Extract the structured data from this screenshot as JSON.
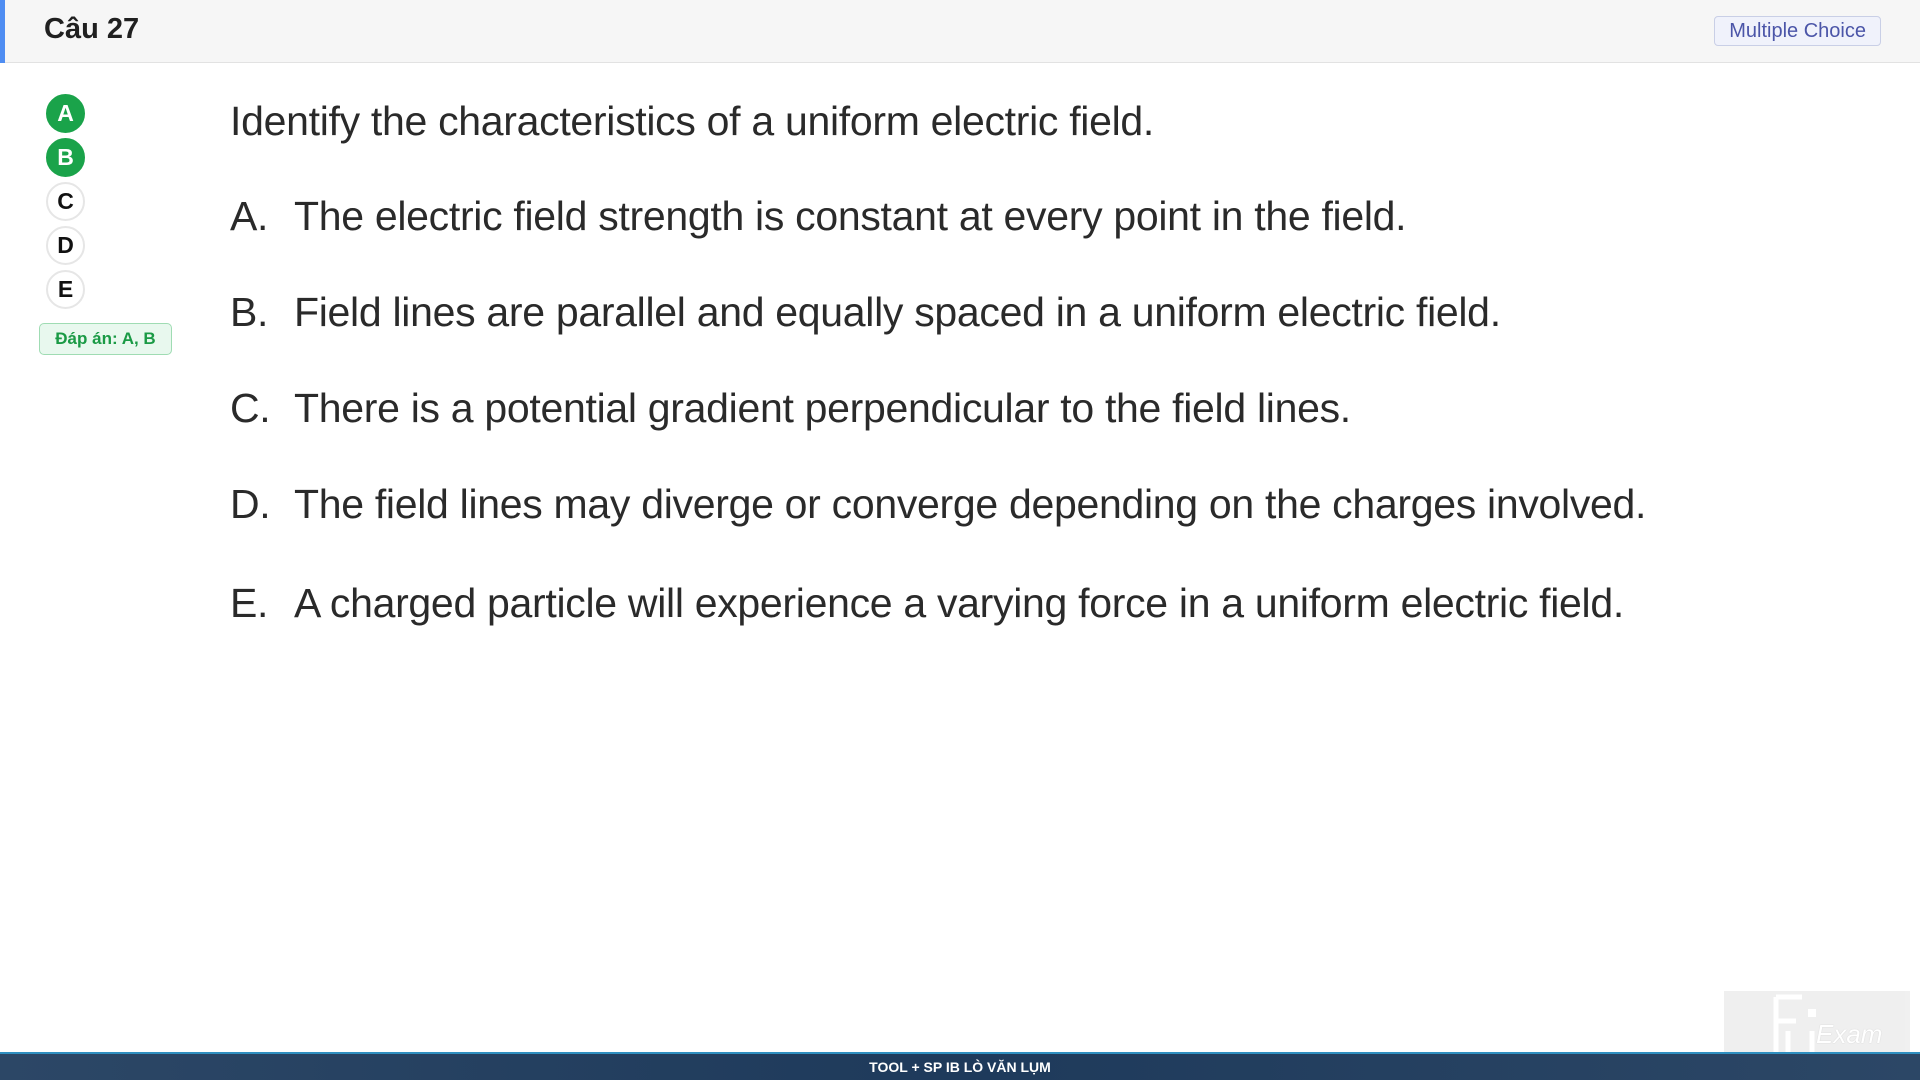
{
  "header": {
    "title": "Câu 27",
    "type_badge": "Multiple Choice"
  },
  "options": [
    {
      "label": "A",
      "correct": true
    },
    {
      "label": "B",
      "correct": true
    },
    {
      "label": "C",
      "correct": false
    },
    {
      "label": "D",
      "correct": false
    },
    {
      "label": "E",
      "correct": false
    }
  ],
  "answer_badge": "Đáp án: A, B",
  "question": {
    "prompt": "Identify the characteristics of a uniform electric field.",
    "choices": [
      {
        "letter": "A.",
        "text": "The electric field strength is constant at every point in the field."
      },
      {
        "letter": "B.",
        "text": "Field lines are parallel and equally spaced in a uniform electric field."
      },
      {
        "letter": "C.",
        "text": "There is a potential gradient perpendicular to the field lines."
      },
      {
        "letter": "D.",
        "text": "The field lines may diverge or converge depending on the charges involved."
      },
      {
        "letter": "E.",
        "text": "A charged particle will experience a varying force in a uniform electric field."
      }
    ]
  },
  "footer": {
    "text": "TOOL + SP IB LÒ VĂN LỤM"
  },
  "watermark": {
    "text": "Exam"
  },
  "colors": {
    "accent": "#4f8df2",
    "correct": "#1aa34a",
    "footer": "#1e3a5b"
  }
}
